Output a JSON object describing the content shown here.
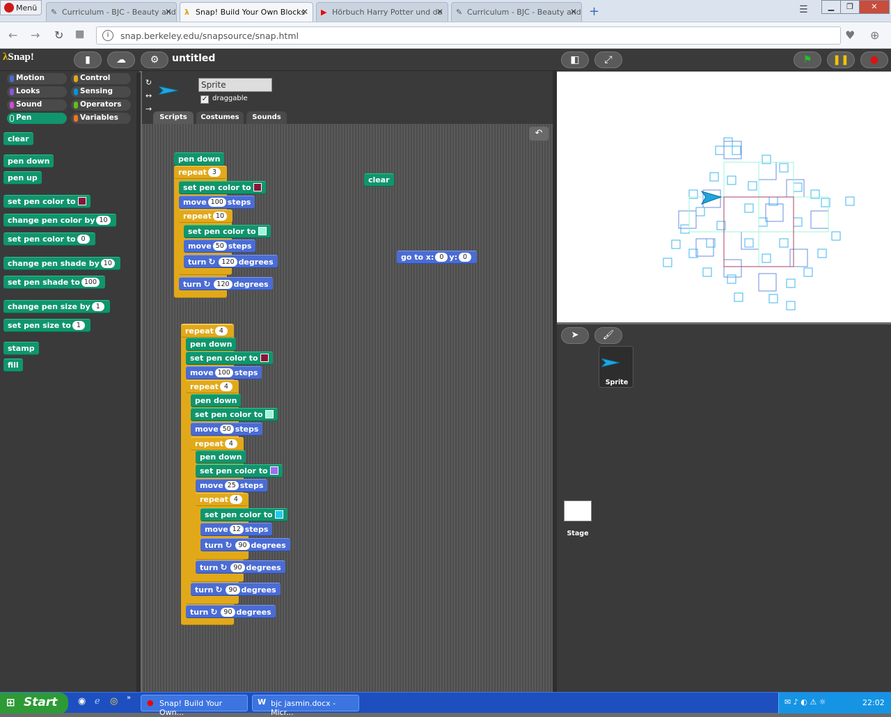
{
  "browser": {
    "menu_label": "Menü",
    "tabs": [
      {
        "title": "Curriculum - BJC - Beauty and",
        "active": false
      },
      {
        "title": "Snap! Build Your Own Blocks",
        "active": true
      },
      {
        "title": "Hörbuch Harry Potter und de",
        "active": false
      },
      {
        "title": "Curriculum - BJC - Beauty and",
        "active": false
      }
    ],
    "url": "snap.berkeley.edu/snapsource/snap.html"
  },
  "snap": {
    "logo": "Snap!",
    "project_title": "untitled",
    "categories": [
      {
        "label": "Motion",
        "color": "#4a6cd4"
      },
      {
        "label": "Control",
        "color": "#e1a91a"
      },
      {
        "label": "Looks",
        "color": "#8a55d7"
      },
      {
        "label": "Sensing",
        "color": "#0494dc"
      },
      {
        "label": "Sound",
        "color": "#cf4ad9"
      },
      {
        "label": "Operators",
        "color": "#62c213"
      },
      {
        "label": "Pen",
        "color": "#10956d"
      },
      {
        "label": "Variables",
        "color": "#f3761d"
      }
    ],
    "selected_category": "Pen",
    "palette": {
      "clear": "clear",
      "pen_down": "pen down",
      "pen_up": "pen up",
      "set_color": "set pen color to",
      "change_color_by": "change pen color by",
      "change_color_val": "10",
      "set_color_to": "set pen color to",
      "set_color_val": "0",
      "change_shade": "change pen shade by",
      "change_shade_val": "10",
      "set_shade": "set pen shade to",
      "set_shade_val": "100",
      "change_size": "change pen size by",
      "change_size_val": "1",
      "set_size": "set pen size to",
      "set_size_val": "1",
      "stamp": "stamp",
      "fill": "fill"
    },
    "sprite": {
      "name": "Sprite",
      "draggable_label": "draggable",
      "draggable": true
    },
    "editor_tabs": [
      "Scripts",
      "Costumes",
      "Sounds"
    ],
    "script1": {
      "pen_down": "pen down",
      "repeat": "repeat",
      "repeat_val": "3",
      "set_color": "set pen color to",
      "color1": "#8a1438",
      "move": "move",
      "move_val": "100",
      "steps": "steps",
      "repeat2_val": "10",
      "color2": "#9ff5d9",
      "move2_val": "50",
      "turn": "turn",
      "turn_val": "120",
      "degrees": "degrees"
    },
    "script_clear": "clear",
    "script_goto": {
      "label": "go to x:",
      "x": "0",
      "y_label": "y:",
      "y": "0"
    },
    "script2": {
      "repeat": "repeat",
      "repeat_val": "4",
      "pen_down": "pen down",
      "set_color": "set pen color to",
      "color1": "#8a1438",
      "color2": "#9ff5d9",
      "color3": "#9c6ef0",
      "color4": "#22c8f0",
      "move": "move",
      "steps": "steps",
      "move1_val": "100",
      "move2_val": "50",
      "move3_val": "25",
      "move4_val": "12",
      "turn": "turn",
      "degrees": "degrees",
      "turn_val": "90"
    },
    "corral": {
      "sprite_label": "Sprite",
      "stage_label": "Stage"
    }
  },
  "taskbar": {
    "start": "Start",
    "items": [
      "Snap! Build Your Own...",
      "bjc jasmin.docx - Micr..."
    ],
    "clock": "22:02"
  }
}
